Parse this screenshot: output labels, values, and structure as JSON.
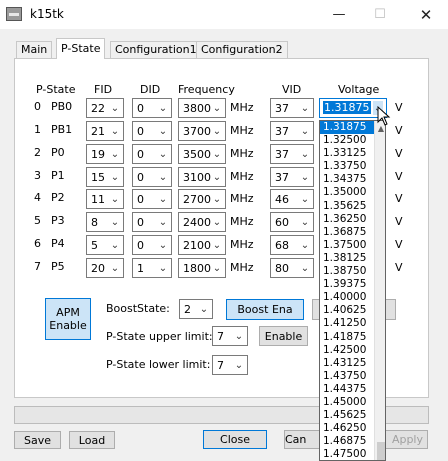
{
  "window": {
    "title": "k15tk",
    "min": "—",
    "max": "☐",
    "close": "✕"
  },
  "tabs": [
    "Main",
    "P-State",
    "Configuration1",
    "Configuration2"
  ],
  "headers": {
    "pstate": "P-State",
    "fid": "FID",
    "did": "DID",
    "freq": "Frequency",
    "vid": "VID",
    "voltage": "Voltage"
  },
  "unit_mhz": "MHz",
  "v_unit": "V",
  "rows": [
    {
      "num": "0",
      "name": "PB0",
      "fid": "22",
      "did": "0",
      "freq": "3800",
      "vid": "37",
      "voltage": "1.31875"
    },
    {
      "num": "1",
      "name": "PB1",
      "fid": "21",
      "did": "0",
      "freq": "3700",
      "vid": "37"
    },
    {
      "num": "2",
      "name": "P0",
      "fid": "19",
      "did": "0",
      "freq": "3500",
      "vid": "37"
    },
    {
      "num": "3",
      "name": "P1",
      "fid": "15",
      "did": "0",
      "freq": "3100",
      "vid": "37"
    },
    {
      "num": "4",
      "name": "P2",
      "fid": "11",
      "did": "0",
      "freq": "2700",
      "vid": "46"
    },
    {
      "num": "5",
      "name": "P3",
      "fid": "8",
      "did": "0",
      "freq": "2400",
      "vid": "60"
    },
    {
      "num": "6",
      "name": "P4",
      "fid": "5",
      "did": "0",
      "freq": "2100",
      "vid": "68"
    },
    {
      "num": "7",
      "name": "P5",
      "fid": "20",
      "did": "1",
      "freq": "1800",
      "vid": "80"
    }
  ],
  "apm": {
    "line1": "APM",
    "line2": "Enable"
  },
  "boost": {
    "label": "BoostState:",
    "value": "2",
    "button": "Boost Ena"
  },
  "upper": {
    "label": "P-State upper limit:",
    "value": "7",
    "button": "Enable"
  },
  "lower": {
    "label": "P-State lower limit:",
    "value": "7"
  },
  "bottom": {
    "save": "Save",
    "load": "Load",
    "close": "Close",
    "cancel": "Can",
    "apply": "Apply"
  },
  "voltage_options": [
    "1.31875",
    "1.32500",
    "1.33125",
    "1.33750",
    "1.34375",
    "1.35000",
    "1.35625",
    "1.36250",
    "1.36875",
    "1.37500",
    "1.38125",
    "1.38750",
    "1.39375",
    "1.40000",
    "1.40625",
    "1.41250",
    "1.41875",
    "1.42500",
    "1.43125",
    "1.43750",
    "1.44375",
    "1.45000",
    "1.45625",
    "1.46250",
    "1.46875",
    "1.47500"
  ],
  "voltage_selected_index": 0
}
